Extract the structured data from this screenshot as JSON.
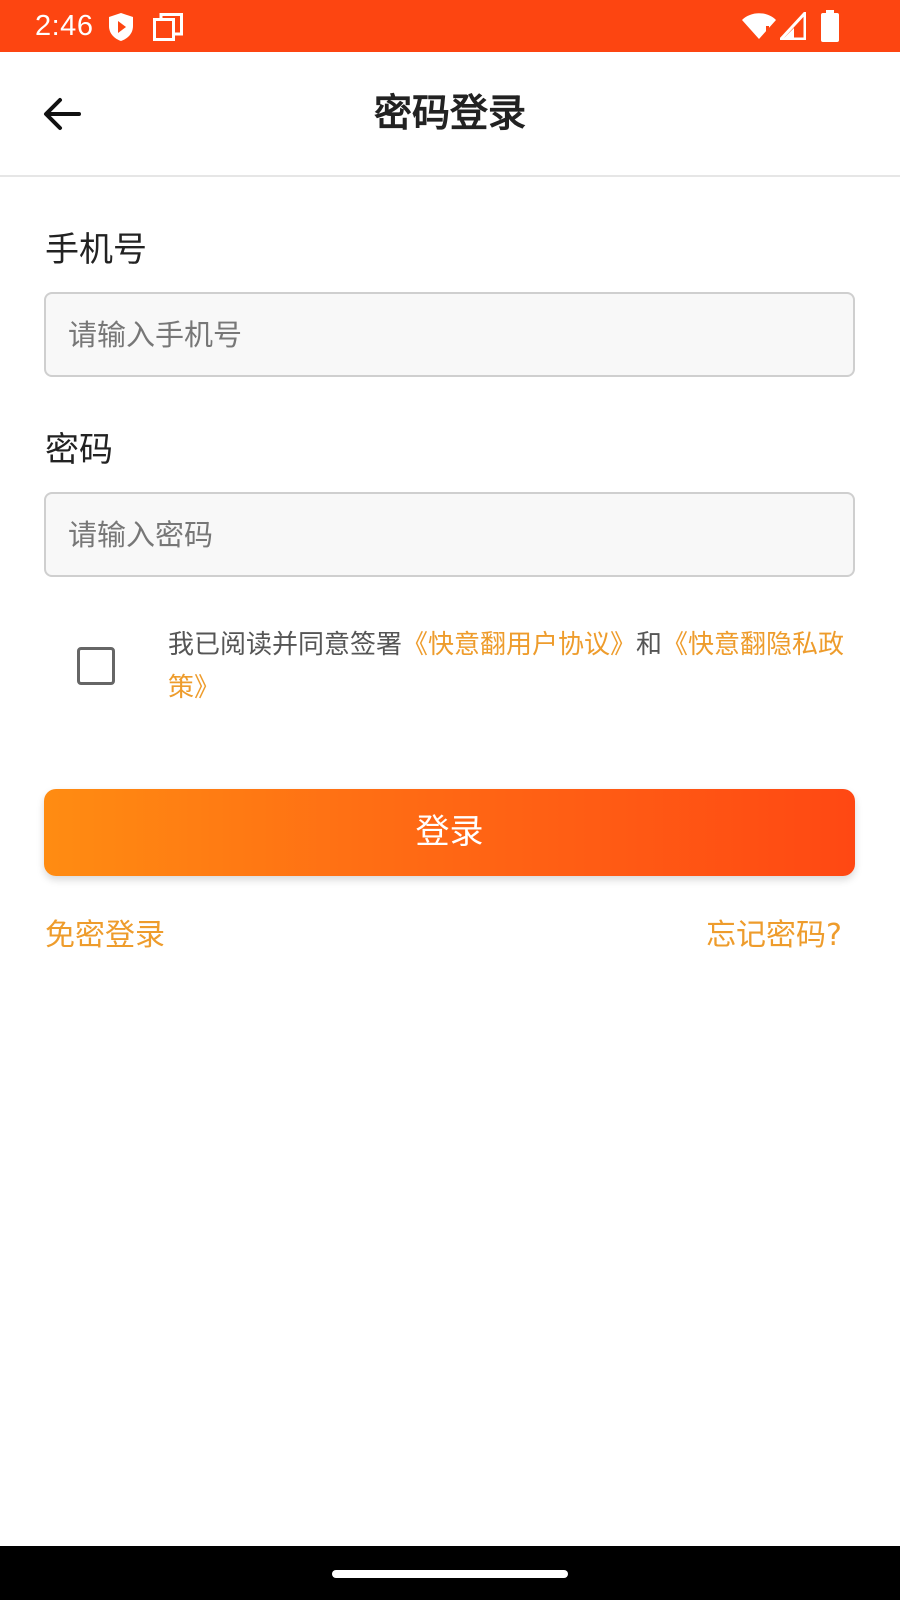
{
  "status_bar": {
    "time": "2:46",
    "background_color": "#fd4511",
    "icons": [
      "shield-icon",
      "copy-icon",
      "wifi-icon",
      "signal-icon",
      "battery-icon"
    ]
  },
  "header": {
    "title": "密码登录",
    "back_icon": "arrow-left-icon"
  },
  "phone_field": {
    "label": "手机号",
    "placeholder": "请输入手机号",
    "value": ""
  },
  "password_field": {
    "label": "密码",
    "placeholder": "请输入密码",
    "value": ""
  },
  "agreement": {
    "checked": false,
    "prefix": "我已阅读并同意签署",
    "user_agreement": "《快意翻用户协议》",
    "conjunction": "和",
    "privacy_policy": "《快意翻隐私政策》"
  },
  "login_button": {
    "label": "登录"
  },
  "links": {
    "passwordless_login": "免密登录",
    "forgot_password": "忘记密码?"
  },
  "colors": {
    "accent": "#ee9c2c",
    "button_gradient_start": "#ff8c12",
    "button_gradient_end": "#ff4813"
  }
}
